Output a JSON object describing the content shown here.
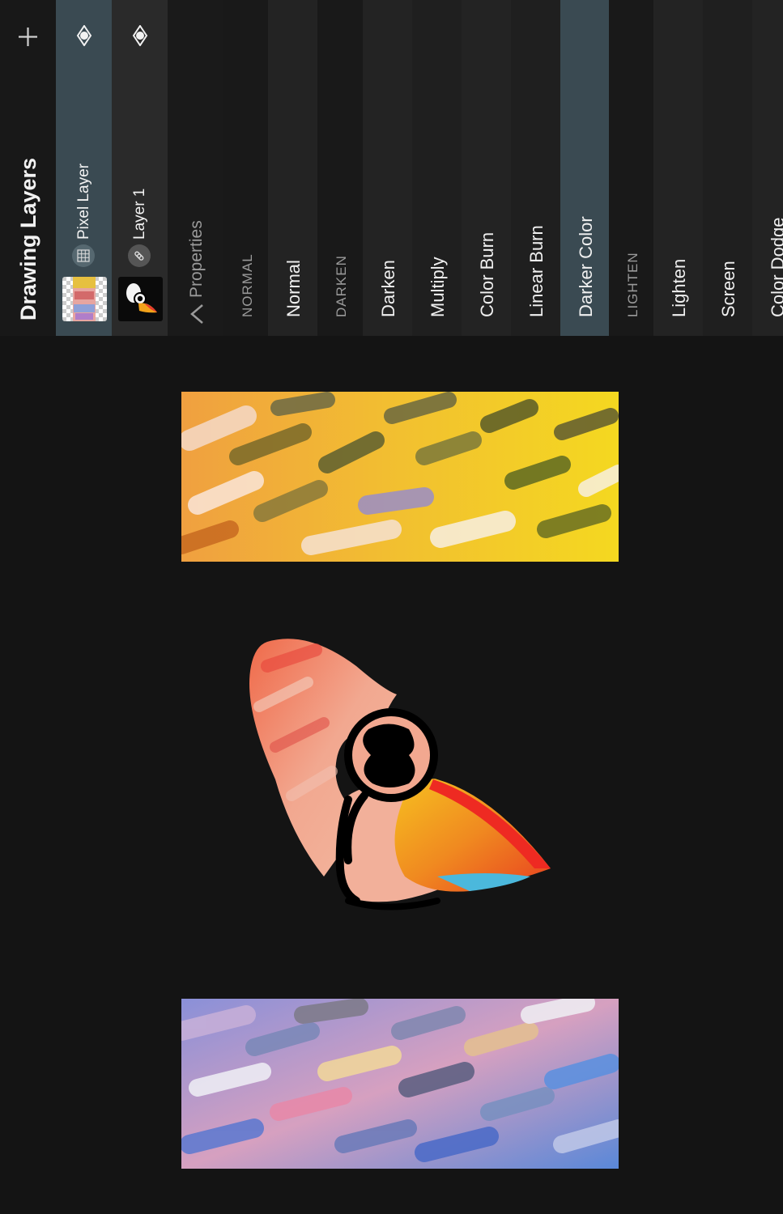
{
  "panel": {
    "title": "Drawing Layers",
    "add_icon": "plus-icon",
    "layers": [
      {
        "name": "Pixel Layer",
        "type_icon": "grid-icon",
        "visibility_icon": "eye-icon",
        "active": true
      },
      {
        "name": "Layer 1",
        "type_icon": "link-icon",
        "visibility_icon": "eye-icon",
        "active": false
      }
    ],
    "properties_label": "Properties",
    "properties_icon": "chevron-down-icon",
    "blend_modes": [
      {
        "label": "NORMAL",
        "kind": "header"
      },
      {
        "label": "Normal",
        "kind": "item"
      },
      {
        "label": "DARKEN",
        "kind": "header"
      },
      {
        "label": "Darken",
        "kind": "item"
      },
      {
        "label": "Multiply",
        "kind": "item"
      },
      {
        "label": "Color Burn",
        "kind": "item"
      },
      {
        "label": "Linear Burn",
        "kind": "item"
      },
      {
        "label": "Darker Color",
        "kind": "item",
        "selected": true
      },
      {
        "label": "LIGHTEN",
        "kind": "header"
      },
      {
        "label": "Lighten",
        "kind": "item"
      },
      {
        "label": "Screen",
        "kind": "item"
      },
      {
        "label": "Color Dodge",
        "kind": "item"
      }
    ]
  },
  "colors": {
    "accent": "#3a4a52",
    "background": "#141414",
    "panel": "#1c1c1c"
  }
}
